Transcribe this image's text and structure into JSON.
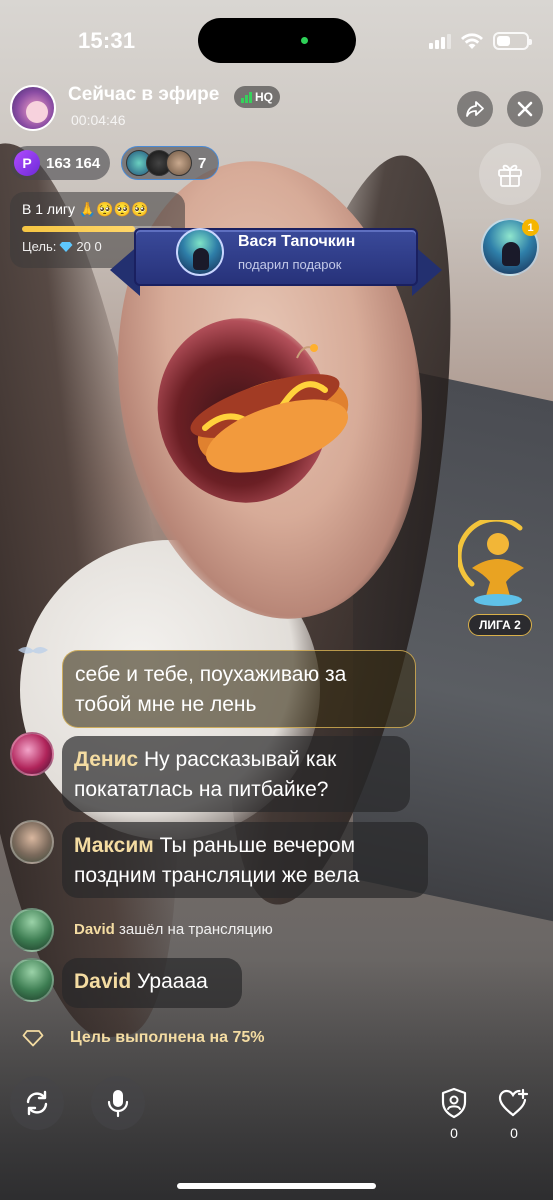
{
  "status_bar": {
    "time": "15:31"
  },
  "header": {
    "title": "Сейчас в эфире",
    "quality_badge": "HQ",
    "timer": "00:04:46"
  },
  "stats": {
    "coins": "163 164",
    "coin_symbol": "P",
    "viewers_count": "7"
  },
  "goal": {
    "title": "В 1 лигу 🙏🥺🥺🥺",
    "progress": 0.75,
    "target_label": "Цель:",
    "target_value": "20 0"
  },
  "gift_banner": {
    "sender": "Вася Тапочкин",
    "action": "подарил подарок"
  },
  "top_viewer": {
    "rank": "1"
  },
  "league": {
    "label": "ЛИГА 2"
  },
  "chat": {
    "messages": [
      {
        "user": "",
        "text": "себе и тебе, поухаживаю за тобой мне не лень"
      },
      {
        "user": "Денис",
        "text": "Ну рассказывай как покататлась на питбайке?"
      },
      {
        "user": "Максим",
        "text": "Ты раньше вечером поздним трансляции же вела"
      },
      {
        "user": "David",
        "text": "Ураааа"
      }
    ],
    "join_event": {
      "user": "David",
      "text": "зашёл на трансляцию"
    },
    "goal_event": "Цель выполнена на 75%"
  },
  "bottom": {
    "guard_count": "0",
    "likes_count": "0"
  },
  "colors": {
    "accent_gold": "#f4dca2",
    "live_green": "#2ed158",
    "coin_purple": "#8e3df0",
    "banner_blue": "#2f3d8a"
  },
  "icons": [
    "share-icon",
    "close-icon",
    "gift-icon",
    "diamond-icon",
    "camera-flip-icon",
    "microphone-icon",
    "shield-user-icon",
    "heart-plus-icon",
    "goal-diamond-icon"
  ]
}
